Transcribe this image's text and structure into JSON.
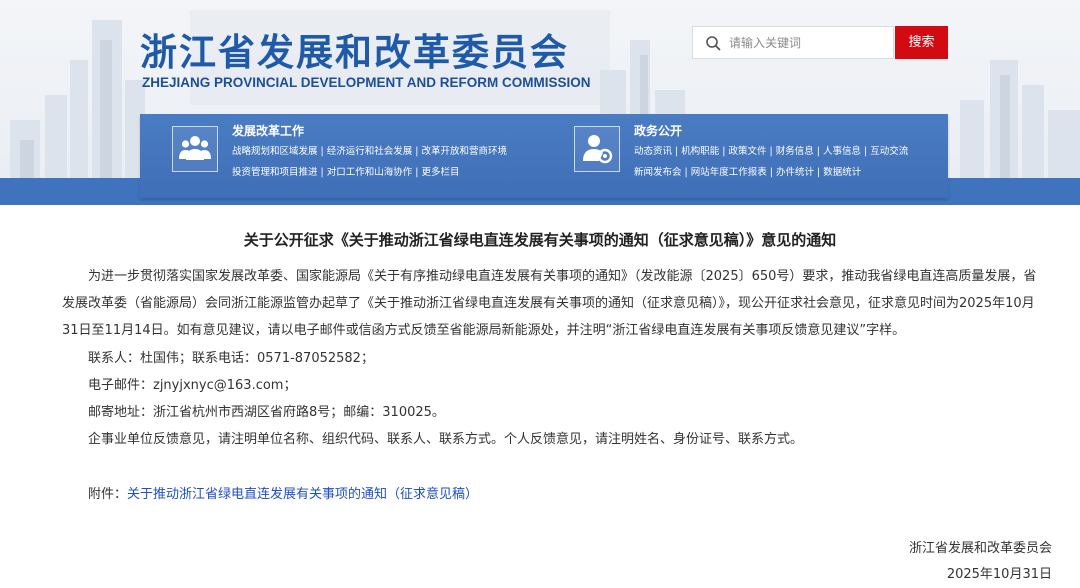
{
  "site": {
    "title_cn": "浙江省发展和改革委员会",
    "title_en": "ZHEJIANG PROVINCIAL DEVELOPMENT AND REFORM COMMISSION"
  },
  "search": {
    "placeholder": "请输入关键词",
    "button_label": "搜索"
  },
  "nav": {
    "left": {
      "title": "发展改革工作",
      "row1": "战略规划和区域发展 | 经济运行和社会发展 | 改革开放和营商环境",
      "row2": "投资管理和项目推进 | 对口工作和山海协作 | 更多栏目"
    },
    "right": {
      "title": "政务公开",
      "row1": "动态资讯 | 机构职能 | 政策文件 | 财务信息 | 人事信息 | 互动交流",
      "row2": "新闻发布会 | 网站年度工作报表 | 办件统计 | 数据统计"
    }
  },
  "article": {
    "title": "关于公开征求《关于推动浙江省绿电直连发展有关事项的通知（征求意见稿）》意见的通知",
    "body_line1": "为进一步贯彻落实国家发展改革委、国家能源局《关于有序推动绿电直连发展有关事项的通知》（发改能源〔2025〕650号）要求，推动我省绿电直连高质量发展，省",
    "body_line2": "发展改革委（省能源局）会同浙江能源监管办起草了《关于推动浙江省绿电直连发展有关事项的通知（征求意见稿）》，现公开征求社会意见，征求意见时间为2025年10月",
    "body_line3": "31日至11月14日。如有意见建议，请以电子邮件或信函方式反馈至省能源局新能源处，并注明“浙江省绿电直连发展有关事项反馈意见建议”字样。",
    "contact": "联系人：杜国伟；联系电话：0571-87052582；",
    "email": "电子邮件：zjnyjxnyc@163.com；",
    "address": "邮寄地址：浙江省杭州市西湖区省府路8号；邮编：310025。",
    "note": "企事业单位反馈意见，请注明单位名称、组织代码、联系人、联系方式。个人反馈意见，请注明姓名、身份证号、联系方式。",
    "attachment_label": "附件：",
    "attachment_link": "关于推动浙江省绿电直连发展有关事项的通知（征求意见稿）",
    "signature_org": "浙江省发展和改革委员会",
    "signature_date": "2025年10月31日"
  },
  "colors": {
    "brand_blue": "#1f5aa8",
    "nav_blue": "#4477bf",
    "search_red": "#d20a11",
    "link_blue": "#1f4fc0"
  }
}
